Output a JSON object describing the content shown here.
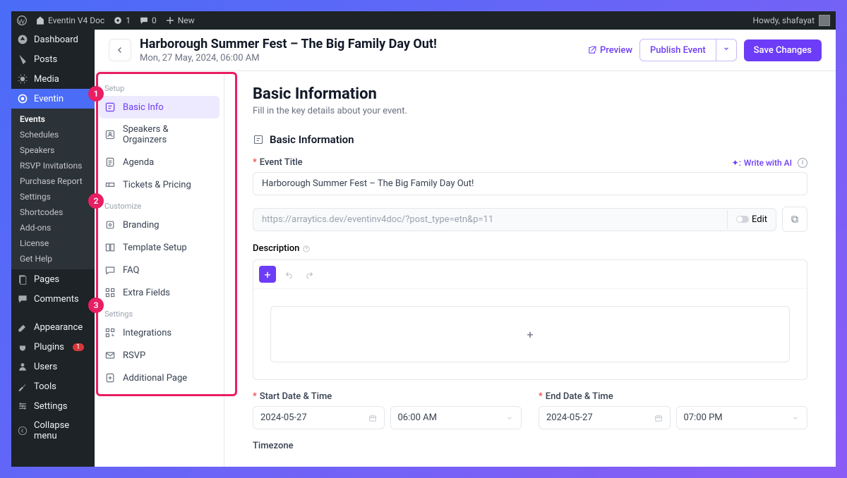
{
  "wp_bar": {
    "site_name": "Eventin V4 Doc",
    "updates": "1",
    "comments": "0",
    "new_label": "New",
    "howdy": "Howdy, shafayat"
  },
  "wp_menu": {
    "dashboard": "Dashboard",
    "posts": "Posts",
    "media": "Media",
    "eventin": "Eventin",
    "submenu": [
      "Events",
      "Schedules",
      "Speakers",
      "RSVP Invitations",
      "Purchase Report",
      "Settings",
      "Shortcodes",
      "Add-ons",
      "License",
      "Get Help"
    ],
    "pages": "Pages",
    "comments": "Comments",
    "appearance": "Appearance",
    "plugins": "Plugins",
    "plugins_badge": "1",
    "users": "Users",
    "tools": "Tools",
    "settings": "Settings",
    "collapse": "Collapse menu"
  },
  "header": {
    "title": "Harborough Summer Fest – The Big Family Day Out!",
    "date": "Mon, 27 May, 2024, 06:00 AM",
    "preview": "Preview",
    "publish": "Publish Event",
    "save": "Save Changes"
  },
  "setup_nav": {
    "sections": {
      "setup": "Setup",
      "customize": "Customize",
      "settings": "Settings"
    },
    "items": {
      "basic_info": "Basic Info",
      "speakers": "Speakers & Orgainzers",
      "agenda": "Agenda",
      "tickets": "Tickets & Pricing",
      "branding": "Branding",
      "template": "Template Setup",
      "faq": "FAQ",
      "extra": "Extra Fields",
      "integrations": "Integrations",
      "rsvp": "RSVP",
      "additional": "Additional Page"
    },
    "badges": {
      "n1": "1",
      "n2": "2",
      "n3": "3"
    }
  },
  "form": {
    "page_title": "Basic Information",
    "page_sub": "Fill in the key details about your event.",
    "section_basic": "Basic Information",
    "event_title_label": "Event Title",
    "write_ai": "Write with AI",
    "event_title_value": "Harborough Summer Fest – The Big Family Day Out!",
    "url_value": "https://arraytics.dev/eventinv4doc/?post_type=etn&p=11",
    "edit_label": "Edit",
    "description_label": "Description",
    "start_label": "Start Date & Time",
    "end_label": "End Date & Time",
    "start_date": "2024-05-27",
    "start_time": "06:00 AM",
    "end_date": "2024-05-27",
    "end_time": "07:00 PM",
    "timezone_label": "Timezone",
    "plus": "+"
  }
}
